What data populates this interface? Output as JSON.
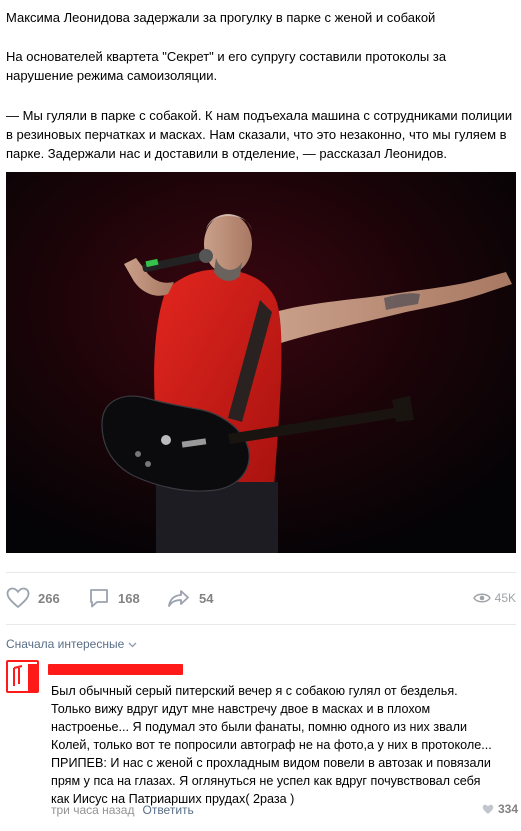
{
  "post": {
    "title": "Максима Леонидова задержали за прогулку в парке с женой и собакой",
    "paragraph_2": "На основателей квартета \"Секрет\" и его супругу составили протоколы за нарушение режима самоизоляции.",
    "paragraph_3": "— Мы гуляли в парке с собакой. К нам подъехала машина с сотрудниками полиции в резиновых перчатках и масках. Нам сказали, что это незаконно, что мы гуляем в парке. Задержали нас и доставили в отделение, — рассказал Леонидов."
  },
  "actions": {
    "likes": "266",
    "comments": "168",
    "shares": "54",
    "views": "45K",
    "icons": [
      "heart-icon",
      "comment-icon",
      "share-icon",
      "eye-icon"
    ]
  },
  "comments_section": {
    "sort_label": "Сначала интересные",
    "comment": {
      "text": "Был обычный серый питерский вечер я с собакою гулял от безделья.\nТолько вижу вдруг идут мне навстречу двое в масках и в плохом\nнастроенье... Я подумал это были фанаты, помню одного из них звали\nКолей, только вот те попросили автограф не на фото,а у них в протоколе...\nПРИПЕВ: И нас с женой с прохладным видом повели в автозак и повязали\nпрям у пса на глазах. Я оглянуться не успел как вдруг почувствовал себя\nкак Иисус на Патриарших прудах( 2раза )",
      "time": "три часа назад",
      "reply_label": "Ответить",
      "likes": "334"
    }
  },
  "colors": {
    "accent_text": "#5a6e87",
    "muted": "#828282",
    "redaction": "#ff1a1a",
    "shirt": "#d81f1c"
  }
}
